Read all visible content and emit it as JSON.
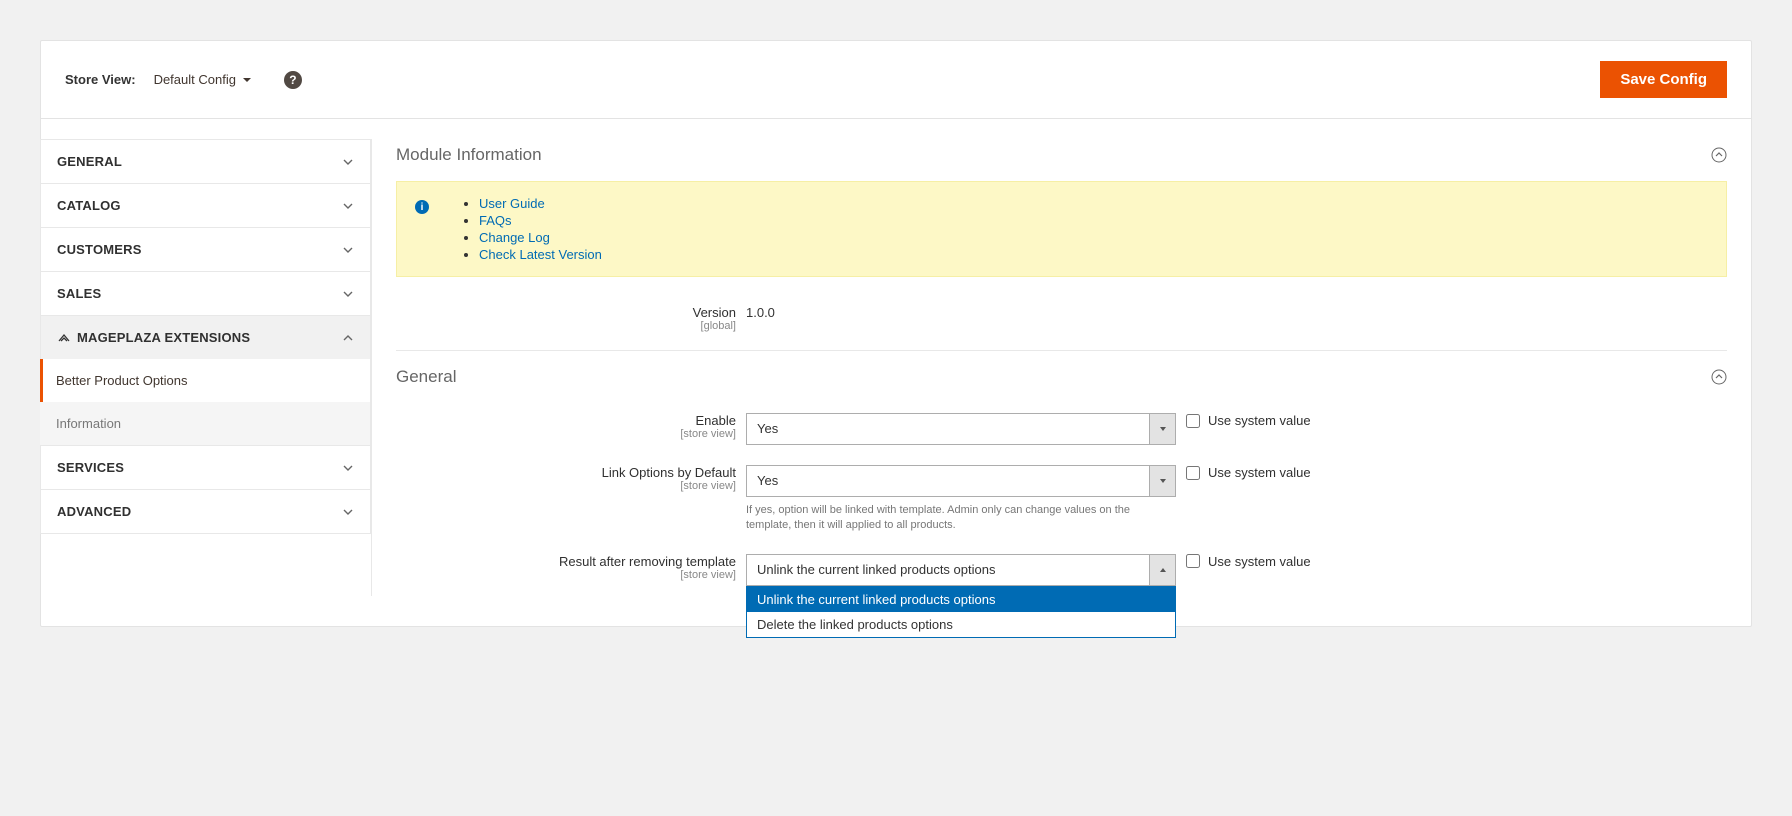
{
  "header": {
    "store_view_label": "Store View:",
    "store_view_value": "Default Config",
    "save_button": "Save Config"
  },
  "sidebar": {
    "sections": [
      {
        "label": "GENERAL",
        "expanded": false
      },
      {
        "label": "CATALOG",
        "expanded": false
      },
      {
        "label": "CUSTOMERS",
        "expanded": false
      },
      {
        "label": "SALES",
        "expanded": false
      },
      {
        "label": "MAGEPLAZA EXTENSIONS",
        "expanded": true,
        "icon": "mageplaza",
        "sub": [
          {
            "label": "Better Product Options",
            "selected": true
          },
          {
            "label": "Information",
            "dim": true
          }
        ]
      },
      {
        "label": "SERVICES",
        "expanded": false
      },
      {
        "label": "ADVANCED",
        "expanded": false
      }
    ]
  },
  "module_info": {
    "title": "Module Information",
    "links": [
      "User Guide",
      "FAQs",
      "Change Log",
      "Check Latest Version"
    ],
    "version_label": "Version",
    "version_scope": "[global]",
    "version_value": "1.0.0"
  },
  "general": {
    "title": "General",
    "use_system_label": "Use system value",
    "fields": {
      "enable": {
        "label": "Enable",
        "scope": "[store view]",
        "value": "Yes"
      },
      "link_options": {
        "label": "Link Options by Default",
        "scope": "[store view]",
        "value": "Yes",
        "hint": "If yes, option will be linked with template. Admin only can change values on the template, then it will applied to all products."
      },
      "result_after_remove": {
        "label": "Result after removing template",
        "scope": "[store view]",
        "value": "Unlink the current linked products options",
        "options": [
          "Unlink the current linked products options",
          "Delete the linked products options"
        ]
      }
    }
  }
}
